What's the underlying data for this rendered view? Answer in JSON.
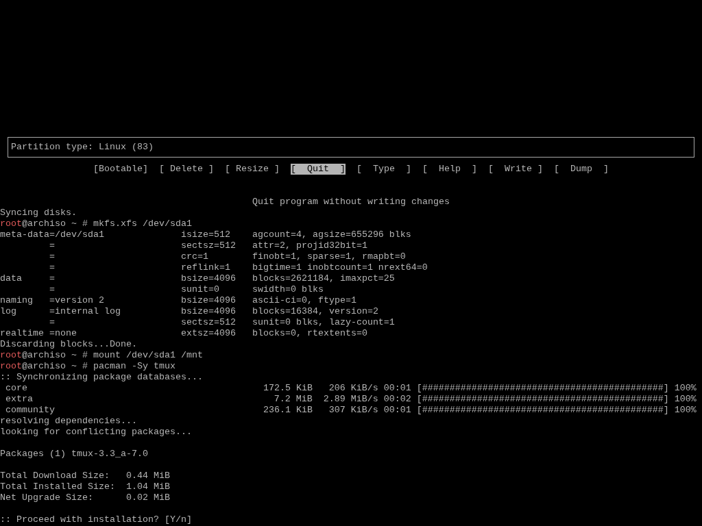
{
  "partition_info": {
    "text": "Partition type: Linux (83)"
  },
  "menu": [
    {
      "label": "[Bootable]",
      "selected": false
    },
    {
      "label": "[ Delete ]",
      "selected": false
    },
    {
      "label": "[ Resize ]",
      "selected": false
    },
    {
      "label": "[  Quit  ]",
      "selected": true
    },
    {
      "label": "[  Type  ]",
      "selected": false
    },
    {
      "label": "[  Help  ]",
      "selected": false
    },
    {
      "label": "[  Write ]",
      "selected": false
    },
    {
      "label": "[  Dump  ]",
      "selected": false
    }
  ],
  "menu_hint": "Quit program without writing changes",
  "terminal": [
    {
      "kind": "text",
      "text": "Syncing disks."
    },
    {
      "kind": "prompt",
      "user": "root",
      "rest": "@archiso ~ # mkfs.xfs /dev/sda1"
    },
    {
      "kind": "text",
      "text": "meta-data=/dev/sda1              isize=512    agcount=4, agsize=655296 blks"
    },
    {
      "kind": "text",
      "text": "         =                       sectsz=512   attr=2, projid32bit=1"
    },
    {
      "kind": "text",
      "text": "         =                       crc=1        finobt=1, sparse=1, rmapbt=0"
    },
    {
      "kind": "text",
      "text": "         =                       reflink=1    bigtime=1 inobtcount=1 nrext64=0"
    },
    {
      "kind": "text",
      "text": "data     =                       bsize=4096   blocks=2621184, imaxpct=25"
    },
    {
      "kind": "text",
      "text": "         =                       sunit=0      swidth=0 blks"
    },
    {
      "kind": "text",
      "text": "naming   =version 2              bsize=4096   ascii-ci=0, ftype=1"
    },
    {
      "kind": "text",
      "text": "log      =internal log           bsize=4096   blocks=16384, version=2"
    },
    {
      "kind": "text",
      "text": "         =                       sectsz=512   sunit=0 blks, lazy-count=1"
    },
    {
      "kind": "text",
      "text": "realtime =none                   extsz=4096   blocks=0, rtextents=0"
    },
    {
      "kind": "text",
      "text": "Discarding blocks...Done."
    },
    {
      "kind": "prompt",
      "user": "root",
      "rest": "@archiso ~ # mount /dev/sda1 /mnt"
    },
    {
      "kind": "prompt",
      "user": "root",
      "rest": "@archiso ~ # pacman -Sy tmux"
    },
    {
      "kind": "text",
      "text": ":: Synchronizing package databases..."
    },
    {
      "kind": "progress",
      "name": "core",
      "size": "172.5 KiB",
      "rate": "206 KiB/s",
      "time": "00:01",
      "bar": "[############################################]",
      "percent": "100%"
    },
    {
      "kind": "progress",
      "name": "extra",
      "size": "7.2 MiB",
      "rate": "2.89 MiB/s",
      "time": "00:02",
      "bar": "[############################################]",
      "percent": "100%"
    },
    {
      "kind": "progress",
      "name": "community",
      "size": "236.1 KiB",
      "rate": "307 KiB/s",
      "time": "00:01",
      "bar": "[############################################]",
      "percent": "100%"
    },
    {
      "kind": "text",
      "text": "resolving dependencies..."
    },
    {
      "kind": "text",
      "text": "looking for conflicting packages..."
    },
    {
      "kind": "blank"
    },
    {
      "kind": "text",
      "text": "Packages (1) tmux-3.3_a-7.0"
    },
    {
      "kind": "blank"
    },
    {
      "kind": "text",
      "text": "Total Download Size:   0.44 MiB"
    },
    {
      "kind": "text",
      "text": "Total Installed Size:  1.04 MiB"
    },
    {
      "kind": "text",
      "text": "Net Upgrade Size:      0.02 MiB"
    },
    {
      "kind": "blank"
    },
    {
      "kind": "text",
      "text": ":: Proceed with installation? [Y/n]"
    }
  ]
}
